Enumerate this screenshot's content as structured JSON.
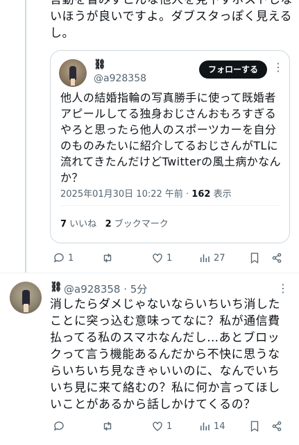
{
  "top_tweet": {
    "text": "言動を省みずこんな他人を見下すポストしないほうが良いですよ。ダブスタっぽく見えるし。"
  },
  "quote": {
    "name": "⛓",
    "handle": "@a928358",
    "follow_label": "フォローする",
    "more": "⋮",
    "body": "他人の結婚指輪の写真勝手に使って既婚者アピールしてる独身おじさんおもろすぎるやろと思ったら他人のスポーツカーを自分のものみたいに紹介してるおじさんがTLに流れてきたんだけどTwitterの風土病かなんか？",
    "timestamp": "2025年01月30日 10:22 午前 · ",
    "views_count": "162",
    "views_label": " 表示",
    "likes_count": "7",
    "likes_label": " いいね",
    "bookmarks_count": "2",
    "bookmarks_label": " ブックマーク"
  },
  "actions1": {
    "replies": "1",
    "retweets": "",
    "likes": "1",
    "views": "27"
  },
  "reply": {
    "name": "⛓",
    "handle_time": "@a928358 · 5分",
    "more": "⋮",
    "body": "消したらダメじゃないならいちいち消したことに突っ込む意味ってなに？私が通信費払ってる私のスマホなんだし…あとブロックって言う機能あるんだから不快に思うならいちいち見なきゃいいのに、なんでいちいち見に来て絡むの？私に何か言ってほしいことがあるから話しかけてくるの？"
  },
  "actions2": {
    "replies": "",
    "retweets": "",
    "likes": "1",
    "views": "14"
  },
  "colors": {
    "text": "#0f1419",
    "secondary": "#536471",
    "border": "#cfd9de"
  },
  "icons": [
    "reply-icon",
    "retweet-icon",
    "like-icon",
    "views-icon",
    "bookmark-icon",
    "share-icon"
  ]
}
